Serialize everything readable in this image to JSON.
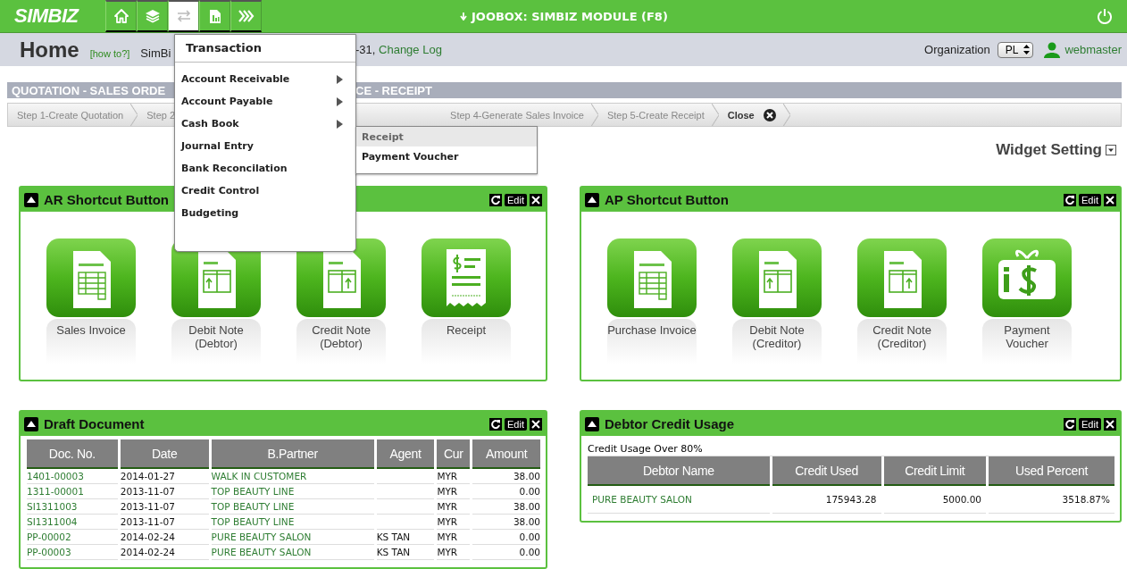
{
  "topbar": {
    "logo": "SIMBIZ",
    "nav": [
      {
        "kind": "home",
        "selected": false
      },
      {
        "kind": "layers",
        "selected": false
      },
      {
        "kind": "transfer",
        "selected": true
      },
      {
        "kind": "report",
        "selected": false
      },
      {
        "kind": "more",
        "selected": false
      }
    ],
    "title": "JOOBOX: SIMBIZ MODULE (F8)"
  },
  "header": {
    "title": "Home",
    "help_link": "[how to?]",
    "info_start": "SimBi",
    "info_end": "-31,",
    "change_log_link": "Change Log",
    "organization_label": "Organization",
    "organization_value": "PL",
    "user": "webmaster"
  },
  "workflow": {
    "banner_start": "QUOTATION - SALES ORDE",
    "banner_end": "CE - RECEIPT",
    "steps": [
      {
        "kind": "step",
        "label": "Step 1-Create Quotation"
      },
      {
        "kind": "step",
        "label": "Step 2"
      },
      {
        "kind": "step",
        "label": "Step 4-Generate Sales Invoice"
      },
      {
        "kind": "step",
        "label": "Step 5-Create Receipt"
      },
      {
        "kind": "close",
        "label": "Close"
      }
    ]
  },
  "widget_setting": "Widget Setting",
  "ar_widget": {
    "title": "AR Shortcut Button",
    "edit": "Edit",
    "shortcuts": [
      {
        "kind": "invoice",
        "label": "Sales Invoice"
      },
      {
        "kind": "note-left",
        "label": "Debit Note (Debtor)"
      },
      {
        "kind": "note-right",
        "label": "Credit Note (Debtor)"
      },
      {
        "kind": "receipt",
        "label": "Receipt"
      }
    ]
  },
  "ap_widget": {
    "title": "AP Shortcut Button",
    "edit": "Edit",
    "shortcuts": [
      {
        "kind": "invoice",
        "label": "Purchase Invoice"
      },
      {
        "kind": "note-left",
        "label": "Debit Note (Creditor)"
      },
      {
        "kind": "note-right",
        "label": "Credit Note (Creditor)"
      },
      {
        "kind": "voucher",
        "label": "Payment Voucher"
      }
    ]
  },
  "draft_widget": {
    "title": "Draft Document",
    "edit": "Edit",
    "columns": [
      "Doc. No.",
      "Date",
      "B.Partner",
      "Agent",
      "Cur",
      "Amount"
    ],
    "rows": [
      [
        "1401-00003",
        "2014-01-27",
        "WALK IN CUSTOMER",
        "",
        "MYR",
        "38.00"
      ],
      [
        "1311-00001",
        "2013-11-07",
        "TOP BEAUTY LINE",
        "",
        "MYR",
        "0.00"
      ],
      [
        "SI1311003",
        "2013-11-07",
        "TOP BEAUTY LINE",
        "",
        "MYR",
        "38.00"
      ],
      [
        "SI1311004",
        "2013-11-07",
        "TOP BEAUTY LINE",
        "",
        "MYR",
        "38.00"
      ],
      [
        "PP-00002",
        "2014-02-24",
        "PURE BEAUTY SALON",
        "KS TAN",
        "MYR",
        "0.00"
      ],
      [
        "PP-00003",
        "2014-02-24",
        "PURE BEAUTY SALON",
        "KS TAN",
        "MYR",
        "0.00"
      ]
    ]
  },
  "credit_widget": {
    "title": "Debtor Credit Usage",
    "edit": "Edit",
    "caption": "Credit Usage Over 80%",
    "columns": [
      "Debtor Name",
      "Credit Used",
      "Credit Limit",
      "Used Percent"
    ],
    "rows": [
      [
        "PURE BEAUTY SALON",
        "175943.28",
        "5000.00",
        "3518.87%"
      ]
    ]
  },
  "menu": {
    "title": "Transaction",
    "items": [
      {
        "label": "Account Receivable",
        "submenu": true
      },
      {
        "label": "Account Payable",
        "submenu": true
      },
      {
        "label": "Cash Book",
        "submenu": true
      },
      {
        "label": "Journal Entry",
        "submenu": false
      },
      {
        "label": "Bank Reconcilation",
        "submenu": false
      },
      {
        "label": "Credit Control",
        "submenu": false
      },
      {
        "label": "Budgeting",
        "submenu": false
      }
    ],
    "submenu": [
      {
        "label": "Receipt",
        "selected": true
      },
      {
        "label": "Payment Voucher",
        "selected": false
      }
    ]
  }
}
